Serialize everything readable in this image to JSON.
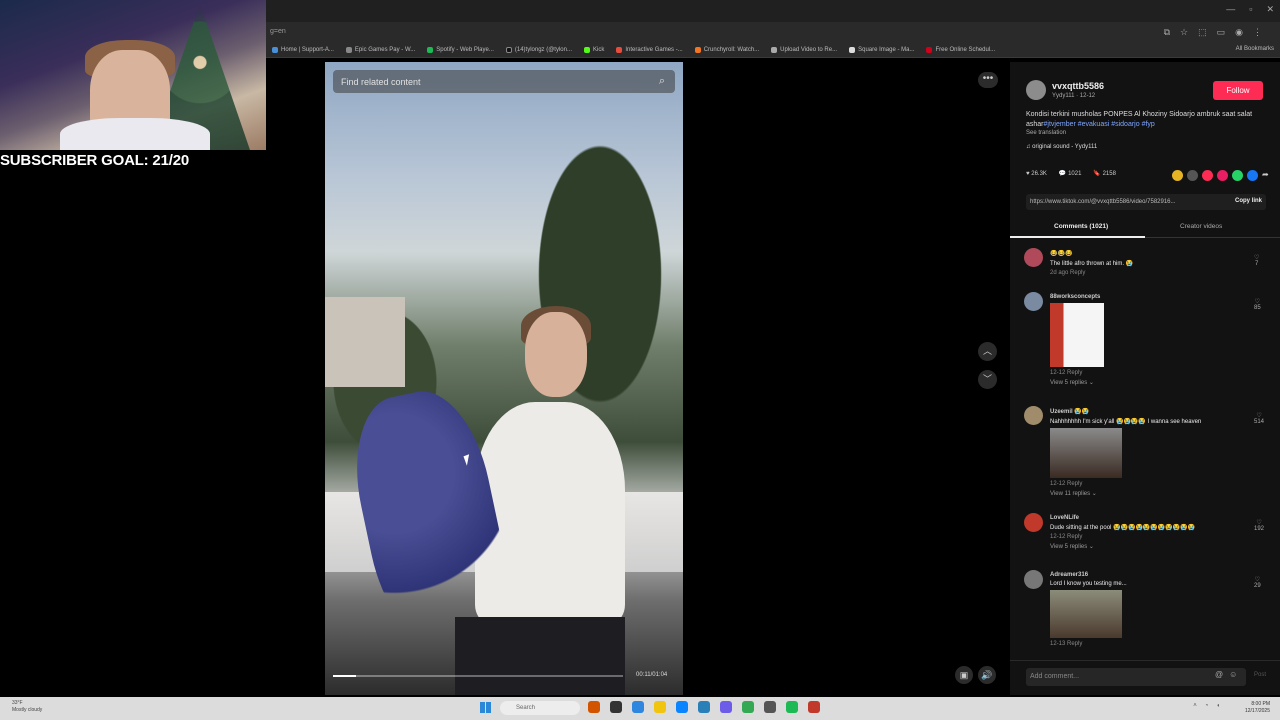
{
  "overlay": {
    "subscriber_goal": "SUBSCRIBER GOAL: 21/20"
  },
  "browser": {
    "address_text": "g=en",
    "bookmarks": [
      {
        "label": "Home | Support-A...",
        "color": "#4a90d9"
      },
      {
        "label": "Epic Games Pay - W...",
        "color": "#888888"
      },
      {
        "label": "Spotify - Web Playe...",
        "color": "#1db954"
      },
      {
        "label": "(14)tylongz (@tylon...",
        "color": "#111111"
      },
      {
        "label": "Kick",
        "color": "#53fc18"
      },
      {
        "label": "Interactive Games -...",
        "color": "#e74c3c"
      },
      {
        "label": "Crunchyroll: Watch...",
        "color": "#f47521"
      },
      {
        "label": "Upload Video to Re...",
        "color": "#aaaaaa"
      },
      {
        "label": "Square Image - Ma...",
        "color": "#dddddd"
      },
      {
        "label": "Free Online Schedul...",
        "color": "#d0021b"
      }
    ],
    "all_bookmarks": "All Bookmarks"
  },
  "video": {
    "search_placeholder": "Find related content",
    "time": "00:11/01:04",
    "progress_fraction": 0.08
  },
  "creator": {
    "username": "vvxqttb5586",
    "subline": "Yydy111 · 12-12",
    "follow_label": "Follow",
    "description": "Kondisi terkini musholas PONPES Al Khoziny Sidoarjo ambruk saat salat ashar",
    "hashtags": "#jtvjember #evakuasi #sidoarjo #fyp",
    "see_translation": "See translation",
    "sound": "original sound - Yydy111"
  },
  "stats": {
    "likes": "26.3K",
    "comments": "1021",
    "saves": "2158"
  },
  "share_colors": [
    "#e6b422",
    "#555555",
    "#fe2c55",
    "#e91e63",
    "#25d366",
    "#1877f2"
  ],
  "link": {
    "url": "https://www.tiktok.com/@vvxqttb5586/video/7582916...",
    "copy_label": "Copy link"
  },
  "tabs": {
    "comments": "Comments (1021)",
    "creator_videos": "Creator videos"
  },
  "comments": [
    {
      "user": "😂😂😂",
      "text": "The little afro thrown at him. 😭",
      "meta": "2d ago   Reply",
      "likes": "7",
      "avatar_color": "#b04a5a"
    },
    {
      "user": "88worksconcepts",
      "text": "",
      "meta": "12-12   Reply",
      "likes": "85",
      "replies": "View 5 replies ⌄",
      "avatar_color": "#7a8aa0"
    },
    {
      "user": "Uzeemil 😭😭",
      "text": "Nahhhhhhh I'm sick y'all 😭😭😭😭 I wanna see heaven",
      "meta": "12-12   Reply",
      "likes": "514",
      "replies": "View 11 replies ⌄",
      "avatar_color": "#a08c6a"
    },
    {
      "user": "LoveNLife",
      "text": "Dude sitting at the pool 😭😭😭😭😭😭😭😭😭😭😭",
      "meta": "12-12   Reply",
      "likes": "192",
      "replies": "View 5 replies ⌄",
      "avatar_color": "#c0392b"
    },
    {
      "user": "Adreamer316",
      "text": "Lord I know you testing me...",
      "meta": "12-13   Reply",
      "likes": "29",
      "avatar_color": "#777777"
    }
  ],
  "add_comment": {
    "placeholder": "Add comment...",
    "post_label": "Post"
  },
  "taskbar": {
    "weather_temp": "33°F",
    "weather_desc": "Mostly cloudy",
    "search_label": "Search",
    "time": "8:00 PM",
    "date": "12/17/2025",
    "app_colors": [
      "#d35400",
      "#333333",
      "#2e86de",
      "#f1c40f",
      "#0a84ff",
      "#2980b9",
      "#6c5ce7",
      "#34a853",
      "#555555",
      "#1db954",
      "#c0392b"
    ]
  }
}
